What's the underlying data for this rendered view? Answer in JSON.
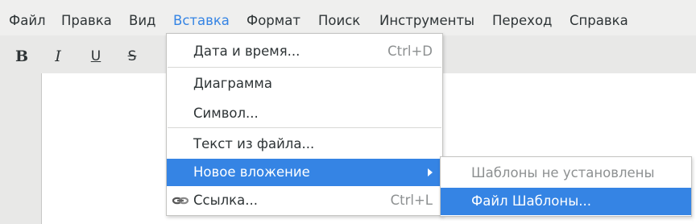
{
  "menubar": {
    "items": [
      {
        "label": "Файл"
      },
      {
        "label": "Правка"
      },
      {
        "label": "Вид"
      },
      {
        "label": "Вставка"
      },
      {
        "label": "Формат"
      },
      {
        "label": "Поиск"
      },
      {
        "label": "Инструменты"
      },
      {
        "label": "Переход"
      },
      {
        "label": "Справка"
      }
    ],
    "active_index": 3,
    "accent_color": "#3584e4"
  },
  "toolbar": {
    "bold": "B",
    "italic": "I",
    "underline": "U",
    "strikethrough": "S"
  },
  "insert_menu": {
    "items": [
      {
        "label": "Дата и время...",
        "accel": "Ctrl+D"
      },
      {
        "label": "Диаграмма"
      },
      {
        "label": "Символ..."
      },
      {
        "label": "Текст из файла..."
      },
      {
        "label": "Новое вложение",
        "has_submenu": true,
        "highlighted": true
      },
      {
        "label": "Ссылка...",
        "accel": "Ctrl+L",
        "icon": "link-icon"
      }
    ]
  },
  "attachment_submenu": {
    "items": [
      {
        "label": "Шаблоны не установлены",
        "disabled": true
      },
      {
        "label": "Файл Шаблоны...",
        "highlighted": true
      }
    ]
  }
}
